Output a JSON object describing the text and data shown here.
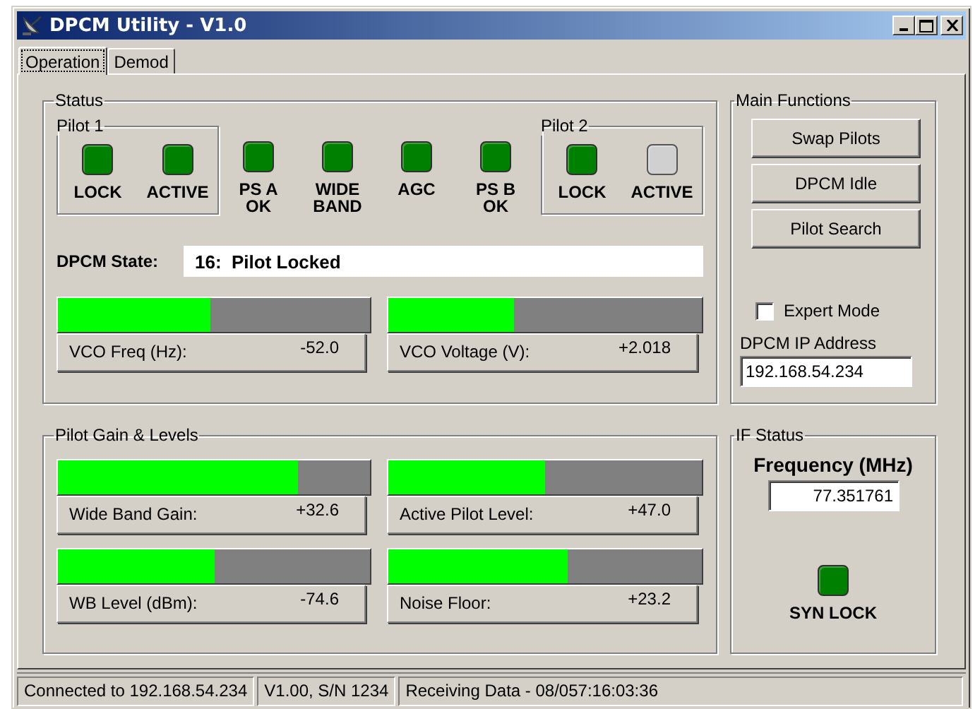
{
  "window": {
    "title": "DPCM Utility - V1.0"
  },
  "tabs": [
    {
      "label": "Operation",
      "selected": true
    },
    {
      "label": "Demod",
      "selected": false
    }
  ],
  "status": {
    "title": "Status",
    "pilot_1": {
      "title": "Pilot 1",
      "indicators": [
        {
          "label": "LOCK",
          "on": true
        },
        {
          "label": "ACTIVE",
          "on": true
        }
      ]
    },
    "indicators": [
      {
        "label": "PS A\nOK",
        "on": true
      },
      {
        "label": "WIDE\nBAND",
        "on": true
      },
      {
        "label": "AGC",
        "on": true
      },
      {
        "label": "PS B\nOK",
        "on": true
      }
    ],
    "pilot_2": {
      "title": "Pilot 2",
      "indicators": [
        {
          "label": "LOCK",
          "on": true
        },
        {
          "label": "ACTIVE",
          "on": false
        }
      ]
    },
    "dpcm_state": {
      "label": "DPCM State:",
      "value": "16:  Pilot Locked"
    },
    "meters": [
      {
        "label": "VCO Freq (Hz):",
        "reading": "-52.0",
        "level": 0.49
      },
      {
        "label": "VCO Voltage (V):",
        "reading": "+2.018",
        "level": 0.4
      }
    ]
  },
  "pilot_gain_levels": {
    "title": "Pilot Gain & Levels",
    "meters": [
      {
        "label": "Wide Band Gain:",
        "reading": "+32.6",
        "level": 0.77
      },
      {
        "label": "Active Pilot Level:",
        "reading": "+47.0",
        "level": 0.5
      },
      {
        "label": "WB Level (dBm):",
        "reading": "-74.6",
        "level": 0.5
      },
      {
        "label": "Noise Floor:",
        "reading": "+23.2",
        "level": 0.57
      }
    ]
  },
  "main_functions": {
    "title": "Main Functions",
    "buttons": [
      "Swap Pilots",
      "DPCM Idle",
      "Pilot Search"
    ],
    "expert_mode": {
      "label": "Expert Mode",
      "checked": false
    },
    "ip_address": {
      "label": "DPCM IP Address",
      "value": "192.168.54.234"
    }
  },
  "if_status": {
    "title": "IF Status",
    "frequency": {
      "label": "Frequency (MHz)",
      "value": "77.351761"
    },
    "indicator": {
      "label": "SYN LOCK",
      "on": true
    }
  },
  "status_bar": [
    "Connected to 192.168.54.234",
    "V1.00, S/N 1234",
    "Receiving Data - 08/057:16:03:36"
  ]
}
